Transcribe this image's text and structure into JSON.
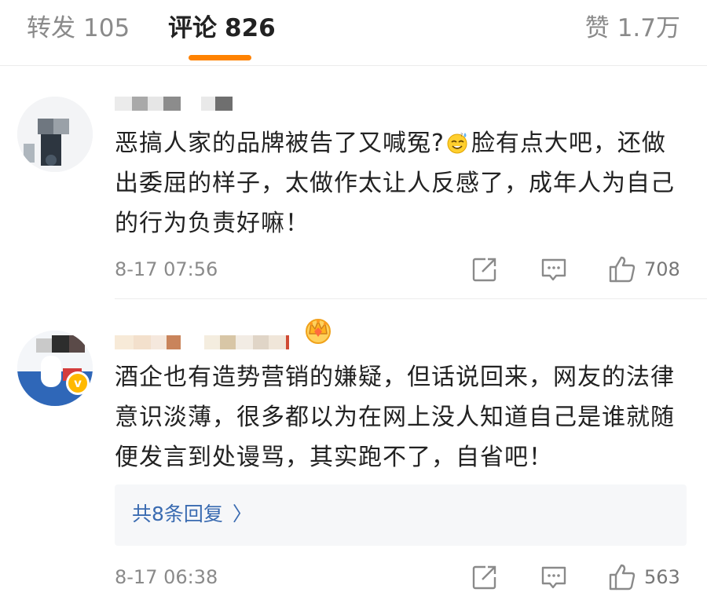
{
  "tabs": [
    {
      "label": "转发",
      "count": "105"
    },
    {
      "label": "评论",
      "count": "826"
    },
    {
      "label": "赞",
      "count": "1.7万"
    }
  ],
  "active_tab": "评论",
  "accent_color": "#ff8200",
  "comments": [
    {
      "text_part1": "恶搞人家的品牌被告了又喊冤?",
      "emoji": "sweat-smile-emoji",
      "text_part2": "脸有点大吧，还做出委屈的样子，太做作太让人反感了，成年人为自己的行为负责好嘛！",
      "timestamp": "8-17 07:56",
      "like_count": "708",
      "icons": [
        "share-icon",
        "comment-icon",
        "like-icon"
      ]
    },
    {
      "text": "酒企也有造势营销的嫌疑，但话说回来，网友的法律意识淡薄，很多都以为在网上没人知道自己是谁就随便发言到处谩骂，其实跑不了，自省吧！",
      "reply_link": "共8条回复",
      "reply_arrow": "〉",
      "timestamp": "8-17 06:38",
      "like_count": "563",
      "verified_badge": "v",
      "icons": [
        "crown-icon",
        "verified-badge-icon",
        "share-icon",
        "comment-icon",
        "like-icon"
      ]
    }
  ]
}
